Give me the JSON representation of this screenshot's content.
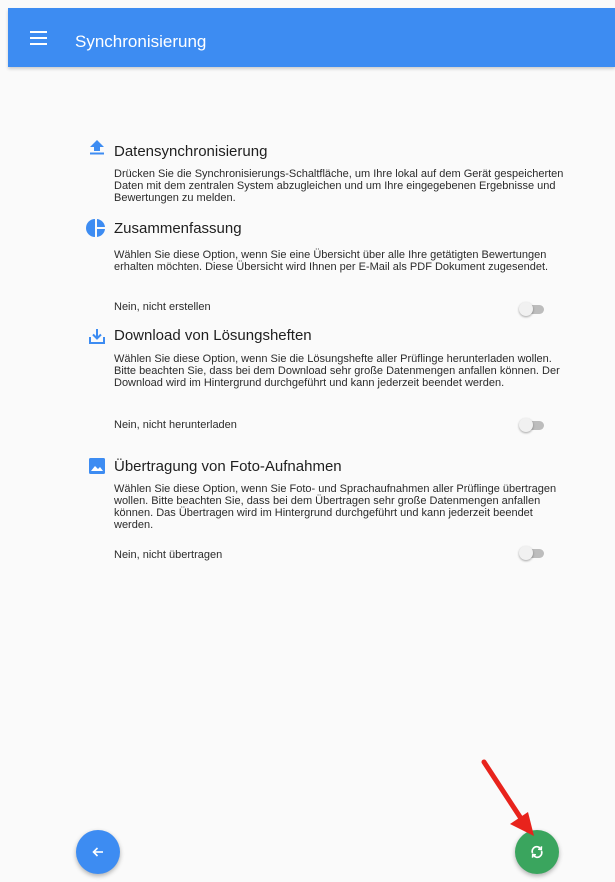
{
  "app_bar": {
    "title": "Synchronisierung",
    "color": "#3d8cf2"
  },
  "sections": [
    {
      "icon": "upload-icon",
      "title": "Datensynchronisierung",
      "description": "Drücken Sie die Synchronisierungs-Schaltfläche, um Ihre lokal auf dem Gerät gespeicherten Daten mit dem zentralen System abzugleichen und um Ihre eingegebenen Ergebnisse und Bewertungen zu melden."
    },
    {
      "icon": "pie-chart-icon",
      "title": "Zusammenfassung",
      "description": "Wählen Sie diese Option, wenn Sie eine Übersicht über alle Ihre getätigten Bewertungen erhalten möchten. Diese Übersicht wird Ihnen per E-Mail als PDF Dokument zugesendet.",
      "option_label": "Nein, nicht erstellen",
      "toggle_on": false
    },
    {
      "icon": "download-icon",
      "title": "Download von Lösungsheften",
      "description": "Wählen Sie diese Option, wenn Sie die Lösungshefte aller Prüflinge herunterladen wollen. Bitte beachten Sie, dass bei dem Download sehr große Datenmengen anfallen können. Der Download wird im Hintergrund durchgeführt und kann jederzeit beendet werden.",
      "option_label": "Nein, nicht herunterladen",
      "toggle_on": false
    },
    {
      "icon": "image-icon",
      "title": "Übertragung von Foto-Aufnahmen",
      "description": "Wählen Sie diese Option, wenn Sie Foto- und Sprachaufnahmen aller Prüflinge übertragen wollen. Bitte beachten Sie, dass bei dem Übertragen sehr große Datenmengen anfallen können. Das Übertragen wird im Hintergrund durchgeführt und kann jederzeit beendet werden.",
      "option_label": "Nein, nicht übertragen",
      "toggle_on": false
    }
  ],
  "fabs": {
    "back": {
      "icon": "arrow-left-icon",
      "color": "#3d8cf2"
    },
    "sync": {
      "icon": "sync-icon",
      "color": "#3aa55e"
    }
  },
  "annotation": {
    "icon": "red-arrow-icon",
    "color": "#e8231c"
  },
  "colors": {
    "accent_blue": "#3d8cf2",
    "toggle_off_track": "#bdbdbd",
    "toggle_off_thumb": "#f1f1f1"
  }
}
